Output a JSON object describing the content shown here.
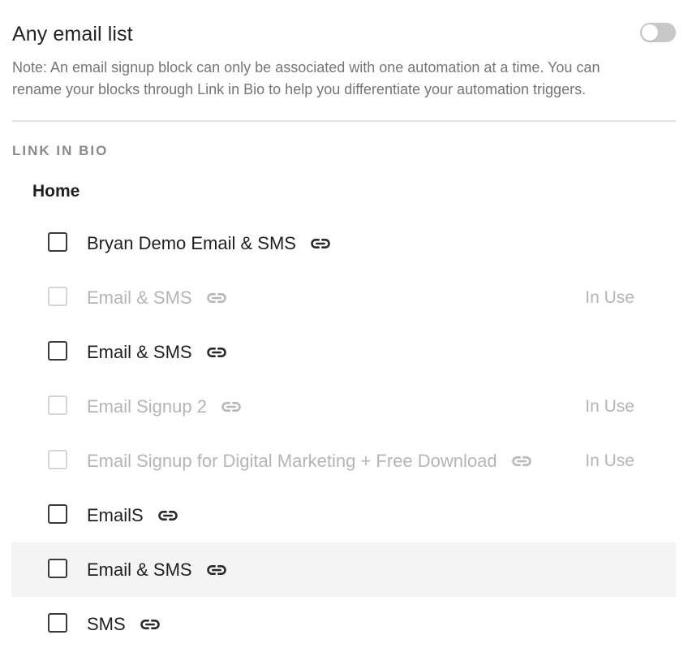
{
  "header": {
    "title": "Any email list",
    "toggle_on": false,
    "note": "Note: An email signup block can only be associated with one automation at a time. You can rename your blocks through Link in Bio to help you differentiate your automation triggers."
  },
  "section": {
    "label": "LINK IN BIO",
    "group_title": "Home"
  },
  "items": [
    {
      "label": "Bryan Demo Email & SMS",
      "status": "",
      "disabled": false,
      "checked": false
    },
    {
      "label": "Email & SMS",
      "status": "In Use",
      "disabled": true,
      "checked": false
    },
    {
      "label": "Email & SMS",
      "status": "",
      "disabled": false,
      "checked": false
    },
    {
      "label": "Email Signup 2",
      "status": "In Use",
      "disabled": true,
      "checked": false
    },
    {
      "label": "Email Signup for Digital Marketing + Free Download",
      "status": "In Use",
      "disabled": true,
      "checked": false
    },
    {
      "label": "EmailS",
      "status": "",
      "disabled": false,
      "checked": false
    },
    {
      "label": "Email & SMS",
      "status": "",
      "disabled": false,
      "checked": false,
      "hovered": true
    },
    {
      "label": "SMS",
      "status": "",
      "disabled": false,
      "checked": false
    }
  ],
  "icons": {
    "link": "link-icon"
  }
}
